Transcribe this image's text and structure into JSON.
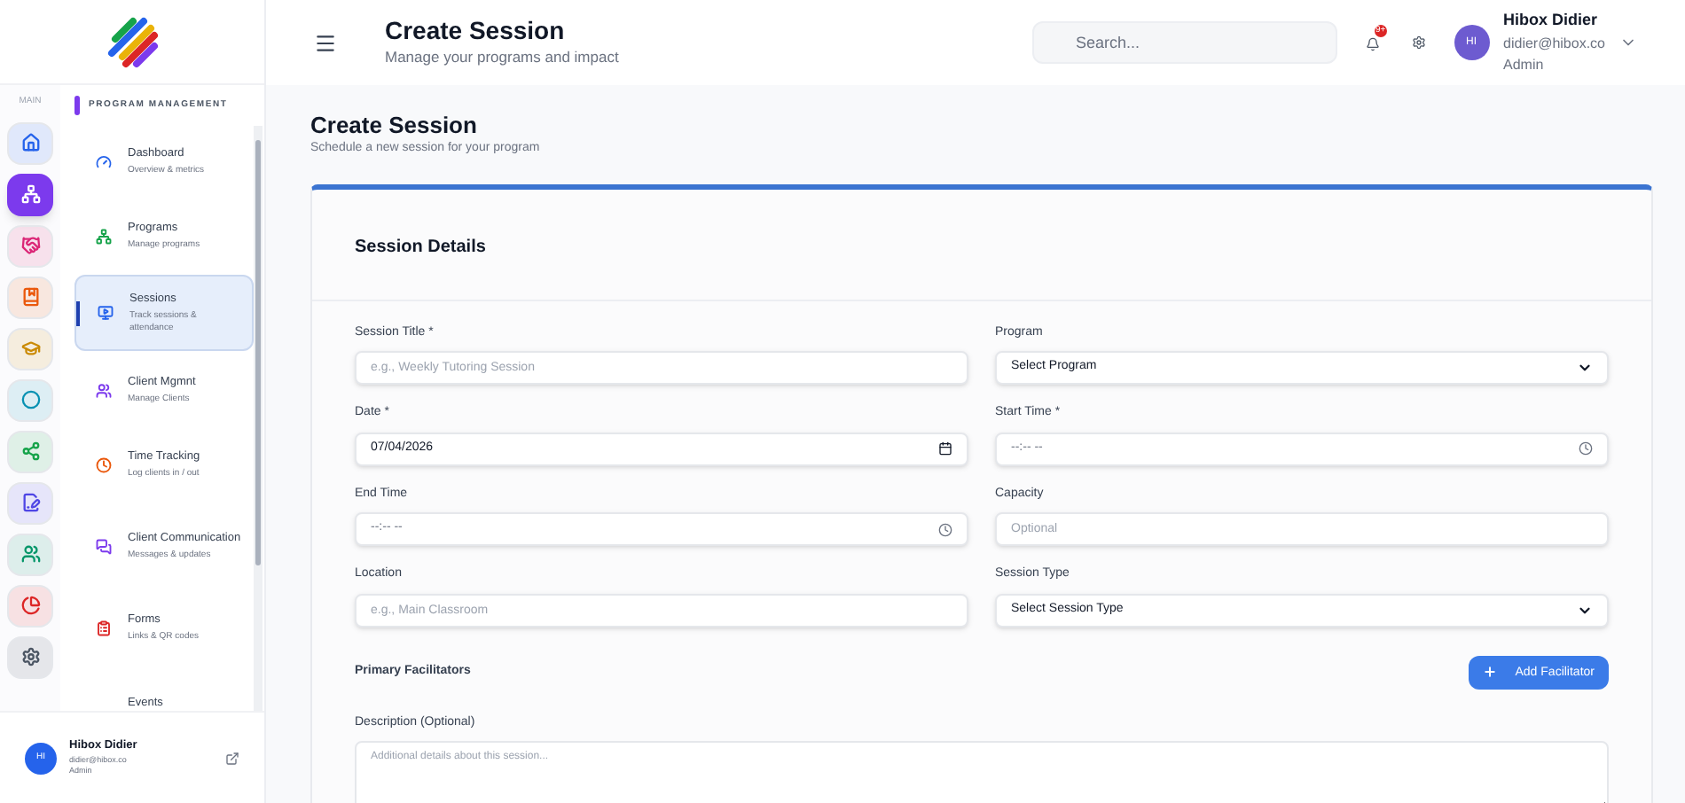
{
  "header": {
    "title": "Create Session",
    "subtitle": "Manage your programs and impact",
    "search": {
      "placeholder": "Search..."
    },
    "notification_badge": "9+",
    "user": {
      "initials": "HI",
      "name": "Hibox Didier",
      "email": "didier@hibox.co",
      "role": "Admin"
    }
  },
  "rail": {
    "label": "MAIN",
    "items": [
      {
        "kind": "home",
        "selected": false,
        "color": "#2563eb"
      },
      {
        "kind": "network",
        "selected": true,
        "color": "#7c3aed"
      },
      {
        "kind": "handshake",
        "selected": false,
        "color": "#db2777"
      },
      {
        "kind": "book",
        "selected": false,
        "color": "#ea580c"
      },
      {
        "kind": "cap",
        "selected": false,
        "color": "#ca8a04"
      },
      {
        "kind": "dot",
        "selected": false,
        "color": "#0891b2"
      },
      {
        "kind": "share",
        "selected": false,
        "color": "#16a34a"
      },
      {
        "kind": "sign",
        "selected": false,
        "color": "#4f46e5"
      },
      {
        "kind": "users",
        "selected": false,
        "color": "#059669"
      },
      {
        "kind": "pie",
        "selected": false,
        "color": "#dc2626"
      },
      {
        "kind": "settings",
        "selected": false,
        "color": "#4b5563"
      }
    ]
  },
  "nav": {
    "section": "PROGRAM MANAGEMENT",
    "items": [
      {
        "kind": "gauge",
        "title": "Dashboard",
        "subtitle": "Overview & metrics",
        "selected": false,
        "color": "#2563eb"
      },
      {
        "kind": "network",
        "title": "Programs",
        "subtitle": "Manage programs",
        "selected": false,
        "color": "#16a34a"
      },
      {
        "kind": "monitor",
        "title": "Sessions",
        "subtitle": "Track sessions & attendance",
        "selected": true,
        "color": "#2563eb"
      },
      {
        "kind": "users",
        "title": "Client Mgmnt",
        "subtitle": "Manage Clients",
        "selected": false,
        "color": "#7c3aed"
      },
      {
        "kind": "clock",
        "title": "Time Tracking",
        "subtitle": "Log clients in / out",
        "selected": false,
        "color": "#ea580c"
      },
      {
        "kind": "chat",
        "title": "Client Communication",
        "subtitle": "Messages & updates",
        "selected": false,
        "color": "#7c3aed"
      },
      {
        "kind": "clipboard",
        "title": "Forms",
        "subtitle": "Links & QR codes",
        "selected": false,
        "color": "#dc2626"
      },
      {
        "kind": "none",
        "title": "Events",
        "selected": false
      }
    ]
  },
  "sidebar_user": {
    "initials": "HI",
    "name": "Hibox Didier",
    "email": "didier@hibox.co",
    "role": "Admin"
  },
  "page": {
    "title": "Create Session",
    "subtitle": "Schedule a new session for your program"
  },
  "card": {
    "title": "Session Details",
    "fields": [
      {
        "kind": "text",
        "label": "Session Title *",
        "placeholder": "e.g., Weekly Tutoring Session"
      },
      {
        "kind": "select",
        "label": "Program",
        "value": "Select Program"
      },
      {
        "kind": "date",
        "label": "Date *",
        "value": "07/04/2026"
      },
      {
        "kind": "time",
        "label": "Start Time *",
        "value": "--:-- --"
      },
      {
        "kind": "time",
        "label": "End Time",
        "value": "--:-- --"
      },
      {
        "kind": "text",
        "label": "Capacity",
        "placeholder": "Optional"
      },
      {
        "kind": "text",
        "label": "Location",
        "placeholder": "e.g., Main Classroom"
      },
      {
        "kind": "select",
        "label": "Session Type",
        "value": "Select Session Type"
      }
    ],
    "facilitators_label": "Primary Facilitators",
    "add_button": "Add Facilitator",
    "description": {
      "label": "Description (Optional)",
      "placeholder": "Additional details about this session..."
    }
  }
}
